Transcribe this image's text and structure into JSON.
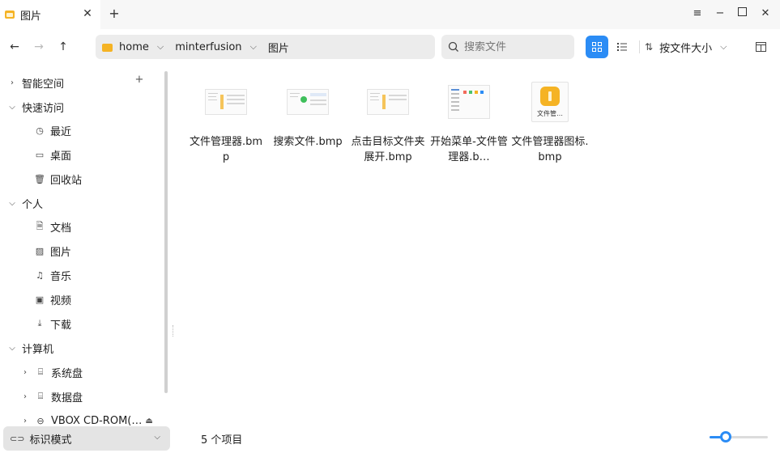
{
  "tab": {
    "label": "图片"
  },
  "breadcrumb": [
    {
      "label": "home"
    },
    {
      "label": "minterfusion"
    },
    {
      "label": "图片"
    }
  ],
  "search": {
    "placeholder": "搜索文件"
  },
  "sort": {
    "label": "按文件大小"
  },
  "sidebar": {
    "items": [
      {
        "label": "智能空间",
        "icon": "chevron-right-icon"
      },
      {
        "label": "快速访问",
        "icon": "chevron-down-icon"
      },
      {
        "label": "最近",
        "icon": "clock-icon"
      },
      {
        "label": "桌面",
        "icon": "monitor-icon"
      },
      {
        "label": "回收站",
        "icon": "trash-icon"
      },
      {
        "label": "个人",
        "icon": "chevron-down-icon"
      },
      {
        "label": "文档",
        "icon": "document-icon"
      },
      {
        "label": "图片",
        "icon": "image-icon"
      },
      {
        "label": "音乐",
        "icon": "music-icon"
      },
      {
        "label": "视频",
        "icon": "video-icon"
      },
      {
        "label": "下载",
        "icon": "download-icon"
      },
      {
        "label": "计算机",
        "icon": "chevron-down-icon"
      },
      {
        "label": "系统盘",
        "icon": "drive-icon"
      },
      {
        "label": "数据盘",
        "icon": "drive-icon"
      },
      {
        "label": "VBOX CD-ROM(…",
        "icon": "cdrom-icon"
      }
    ],
    "tag_mode": {
      "label": "标识模式"
    }
  },
  "files": [
    {
      "name": "文件管理器.bmp"
    },
    {
      "name": "搜索文件.bmp"
    },
    {
      "name": "点击目标文件夹展开.bmp"
    },
    {
      "name": "开始菜单-文件管理器.b…"
    },
    {
      "name": "文件管理器图标.bmp",
      "thumb_label": "文件管…"
    }
  ],
  "status": {
    "count_text": "5 个项目"
  },
  "zoom": {
    "level": 0.28
  },
  "colors": {
    "accent": "#2b8cf5",
    "folder": "#f5b324"
  }
}
